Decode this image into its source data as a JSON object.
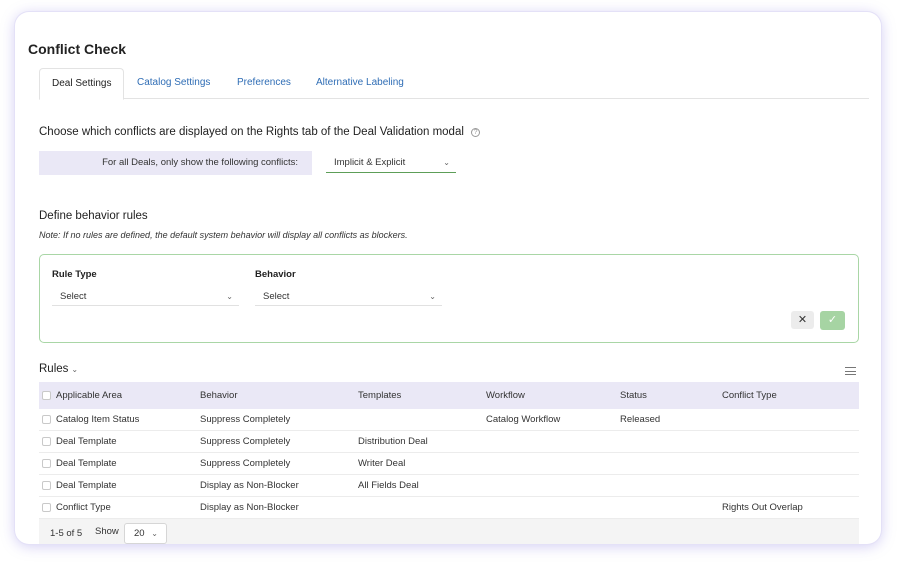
{
  "page": {
    "title": "Conflict Check"
  },
  "tabs": [
    {
      "label": "Deal Settings"
    },
    {
      "label": "Catalog Settings"
    },
    {
      "label": "Preferences"
    },
    {
      "label": "Alternative Labeling"
    }
  ],
  "conflicts": {
    "heading": "Choose which conflicts are displayed on the Rights tab of the Deal Validation modal",
    "help_icon": "?",
    "label": "For all Deals, only show the following conflicts:",
    "selected": "Implicit & Explicit"
  },
  "behavior": {
    "heading": "Define behavior rules",
    "note": "Note: If no rules are defined, the default system behavior will display all conflicts as blockers.",
    "rule_type_label": "Rule Type",
    "rule_type_value": "Select",
    "behavior_label": "Behavior",
    "behavior_value": "Select",
    "cancel_glyph": "✕",
    "confirm_glyph": "✓"
  },
  "rules": {
    "title": "Rules",
    "columns": [
      "Applicable Area",
      "Behavior",
      "Templates",
      "Workflow",
      "Status",
      "Conflict Type"
    ],
    "rows": [
      [
        "Catalog Item Status",
        "Suppress Completely",
        "",
        "Catalog Workflow",
        "Released",
        ""
      ],
      [
        "Deal Template",
        "Suppress Completely",
        "Distribution Deal",
        "",
        "",
        ""
      ],
      [
        "Deal Template",
        "Suppress Completely",
        "Writer Deal",
        "",
        "",
        ""
      ],
      [
        "Deal Template",
        "Display as Non-Blocker",
        "All Fields Deal",
        "",
        "",
        ""
      ],
      [
        "Conflict Type",
        "Display as Non-Blocker",
        "",
        "",
        "",
        "Rights Out Overlap"
      ]
    ],
    "range": "1-5 of 5",
    "show_label": "Show",
    "page_size": "20"
  },
  "colors": {
    "accent_lavender": "#eae8f6",
    "link_blue": "#2f6db5",
    "success_green": "#a6d4a3"
  }
}
